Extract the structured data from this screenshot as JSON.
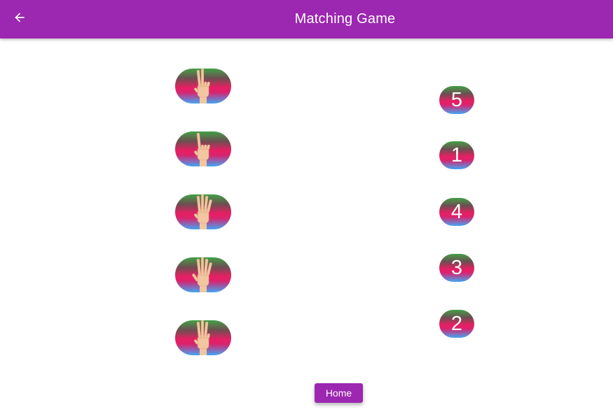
{
  "app_bar": {
    "title": "Matching Game",
    "back_icon": "arrow-back-icon",
    "color": "#9c27b0"
  },
  "hand_cards": [
    {
      "fingers": 2,
      "icon": "hand-two-fingers-icon"
    },
    {
      "fingers": 1,
      "icon": "hand-one-finger-icon"
    },
    {
      "fingers": 4,
      "icon": "hand-four-fingers-icon"
    },
    {
      "fingers": 5,
      "icon": "hand-five-fingers-icon"
    },
    {
      "fingers": 3,
      "icon": "hand-three-fingers-icon"
    }
  ],
  "number_cards": [
    "5",
    "1",
    "4",
    "3",
    "2"
  ],
  "home_button": {
    "label": "Home"
  },
  "colors": {
    "accent": "#9c27b0",
    "gradient_top": "#43a047",
    "gradient_middle": "#e91e63",
    "gradient_bottom": "#42a5f5"
  }
}
